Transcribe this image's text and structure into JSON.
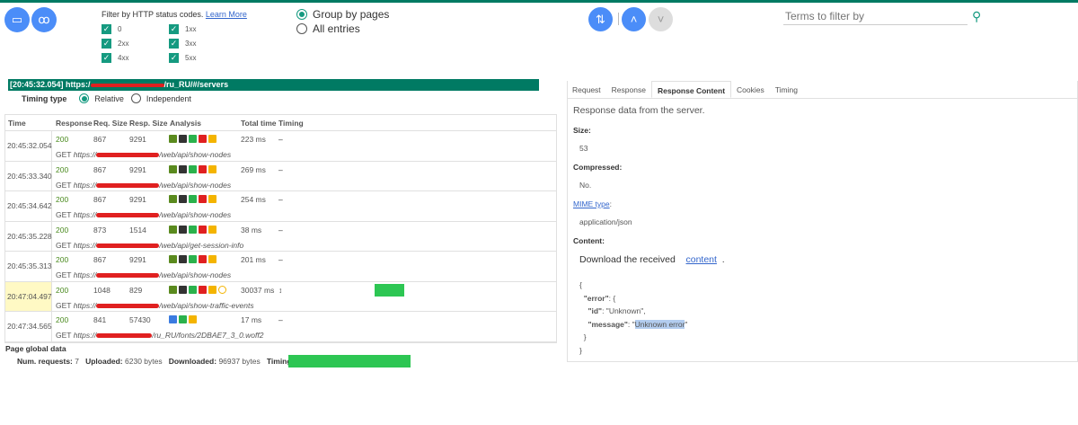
{
  "toolbar": {
    "open_icon": "folder-icon",
    "incognito_icon": "incognito-icon",
    "sort_icon": "sort-icon",
    "prev_icon": "chevron-up-icon",
    "next_icon": "chevron-down-icon"
  },
  "filter": {
    "title": "Filter by HTTP status codes.",
    "learn_more": "Learn More",
    "codes": [
      "0",
      "1xx",
      "2xx",
      "3xx",
      "4xx",
      "5xx"
    ]
  },
  "grouping": {
    "group_by_pages": "Group by pages",
    "all_entries": "All entries"
  },
  "search": {
    "placeholder": "Terms to filter by"
  },
  "page": {
    "time": "[20:45:32.054] https:/",
    "url_suffix": "/ru_RU/#/servers"
  },
  "timing_type": {
    "label": "Timing type",
    "relative": "Relative",
    "independent": "Independent"
  },
  "table": {
    "headers": [
      "Time",
      "Response",
      "Req. Size",
      "Resp. Size",
      "Analysis",
      "Total time",
      "Timing"
    ],
    "rows": [
      {
        "time": "20:45:32.054",
        "status": "200",
        "req": "867",
        "resp": "9291",
        "total": "223 ms",
        "timing": "–",
        "method": "GET",
        "url_prefix": "https://",
        "url_suffix": "/web/api/show-nodes"
      },
      {
        "time": "20:45:33.340",
        "status": "200",
        "req": "867",
        "resp": "9291",
        "total": "269 ms",
        "timing": "–",
        "method": "GET",
        "url_prefix": "https://",
        "url_suffix": "/web/api/show-nodes"
      },
      {
        "time": "20:45:34.642",
        "status": "200",
        "req": "867",
        "resp": "9291",
        "total": "254 ms",
        "timing": "–",
        "method": "GET",
        "url_prefix": "https://",
        "url_suffix": "/web/api/show-nodes"
      },
      {
        "time": "20:45:35.228",
        "status": "200",
        "req": "873",
        "resp": "1514",
        "total": "38 ms",
        "timing": "–",
        "method": "GET",
        "url_prefix": "https://",
        "url_suffix": "/web/api/get-session-info"
      },
      {
        "time": "20:45:35.313",
        "status": "200",
        "req": "867",
        "resp": "9291",
        "total": "201 ms",
        "timing": "–",
        "method": "GET",
        "url_prefix": "https://",
        "url_suffix": "/web/api/show-nodes"
      },
      {
        "time": "20:47:04.497",
        "status": "200",
        "req": "1048",
        "resp": "829",
        "total": "30037 ms",
        "timing": "↕",
        "method": "GET",
        "url_prefix": "https://",
        "url_suffix": "/web/api/show-traffic-events"
      },
      {
        "time": "20:47:34.565",
        "status": "200",
        "req": "841",
        "resp": "57430",
        "total": "17 ms",
        "timing": "–",
        "method": "GET",
        "url_prefix": "https://",
        "url_suffix": "/ru_RU/fonts/2DBAE7_3_0.woff2"
      }
    ]
  },
  "global": {
    "title": "Page global data",
    "num_label": "Num. requests:",
    "num": "7",
    "up_label": "Uploaded:",
    "up": "6230 bytes",
    "down_label": "Downloaded:",
    "down": "96937 bytes",
    "timings_label": "Timings:",
    "timings_icon": "↕"
  },
  "details": {
    "tabs": [
      "Request",
      "Response",
      "Response Content",
      "Cookies",
      "Timing"
    ],
    "intro": "Response data from the server.",
    "size_label": "Size:",
    "size": "53",
    "compressed_label": "Compressed:",
    "compressed": "No.",
    "mime_label": "MIME type",
    "mime_colon": ":",
    "mime": "application/json",
    "content_label": "Content:",
    "download_text": "Download the received",
    "download_link": "content",
    "download_end": ".",
    "json_l1": "{",
    "json_l2a": "\"error\"",
    "json_l2b": ": {",
    "json_l3a": "\"id\"",
    "json_l3b": ": \"Unknown\",",
    "json_l4a": "\"message\"",
    "json_l4b": ": \"",
    "json_l4c": "Unknown error",
    "json_l4d": "\"",
    "json_l5": "}",
    "json_l6": "}"
  },
  "colors": {
    "accent": "#007a63",
    "button": "#4b8df8",
    "selected_row": "#fff9c4",
    "timing_bar": "#2dc653"
  }
}
